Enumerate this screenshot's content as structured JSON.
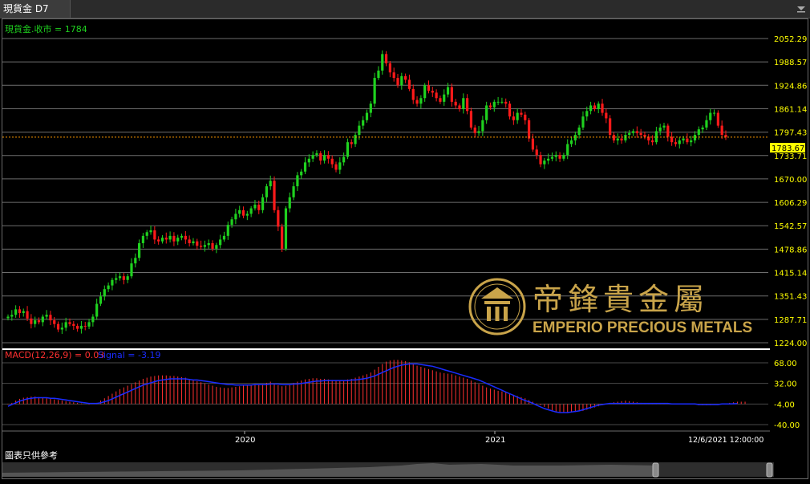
{
  "tab": {
    "title": "現貨金 D7"
  },
  "price_panel": {
    "legend": "現貨金.收市 = 1784",
    "current_price_label": "1783.67"
  },
  "macd_panel": {
    "legend_macd": "MACD(12,26,9) = 0.03",
    "legend_signal": "Signal = -3.19"
  },
  "footer": {
    "disclaimer": "圖表只供參考",
    "date_label": "12/6/2021 12:00:00"
  },
  "watermark": {
    "chinese": "帝鋒貴金屬",
    "english": "EMPERIO PRECIOUS METALS"
  },
  "colors": {
    "up": "#1fd11f",
    "down": "#ff1a1a",
    "signal": "#1a2cff",
    "macd_text": "#ff3030",
    "axis_text": "#ffff00",
    "current_price_bg": "#ffff00",
    "logo_gold": "#c9a44a",
    "hist": "#ff3030",
    "price_line": "#ff9900"
  },
  "chart_data": [
    {
      "type": "candlestick",
      "title": "現貨金.收市 = 1784",
      "y_ticks": [
        "2052.29",
        "1988.57",
        "1924.86",
        "1861.14",
        "1797.43",
        "1733.71",
        "1670.00",
        "1606.29",
        "1542.57",
        "1478.86",
        "1415.14",
        "1351.43",
        "1287.71",
        "1224.00"
      ],
      "ylim": [
        1224.0,
        2052.29
      ],
      "x_labels": [
        "2020",
        "2021"
      ],
      "last_close": 1783.67,
      "series": [
        {
          "name": "現貨金.收市",
          "close": [
            1295,
            1300,
            1315,
            1305,
            1310,
            1290,
            1275,
            1285,
            1280,
            1295,
            1300,
            1285,
            1275,
            1260,
            1265,
            1280,
            1275,
            1270,
            1262,
            1270,
            1268,
            1280,
            1295,
            1330,
            1350,
            1370,
            1380,
            1395,
            1400,
            1405,
            1395,
            1405,
            1440,
            1455,
            1495,
            1515,
            1525,
            1530,
            1505,
            1500,
            1510,
            1505,
            1515,
            1500,
            1510,
            1515,
            1505,
            1495,
            1500,
            1488,
            1485,
            1490,
            1495,
            1480,
            1490,
            1505,
            1515,
            1545,
            1560,
            1575,
            1585,
            1570,
            1575,
            1590,
            1600,
            1585,
            1620,
            1650,
            1665,
            1585,
            1540,
            1480,
            1590,
            1620,
            1650,
            1680,
            1690,
            1715,
            1725,
            1735,
            1740,
            1720,
            1735,
            1725,
            1710,
            1695,
            1715,
            1730,
            1770,
            1765,
            1790,
            1815,
            1830,
            1850,
            1875,
            1945,
            1965,
            2010,
            1985,
            1960,
            1945,
            1925,
            1950,
            1940,
            1915,
            1885,
            1875,
            1890,
            1925,
            1910,
            1905,
            1890,
            1880,
            1900,
            1920,
            1880,
            1870,
            1860,
            1890,
            1855,
            1810,
            1795,
            1800,
            1830,
            1870,
            1865,
            1880,
            1880,
            1880,
            1875,
            1840,
            1830,
            1850,
            1845,
            1830,
            1780,
            1750,
            1735,
            1710,
            1720,
            1725,
            1730,
            1735,
            1725,
            1735,
            1765,
            1775,
            1790,
            1810,
            1840,
            1855,
            1870,
            1860,
            1875,
            1850,
            1835,
            1790,
            1775,
            1780,
            1775,
            1790,
            1795,
            1800,
            1795,
            1790,
            1785,
            1775,
            1770,
            1800,
            1810,
            1815,
            1785,
            1770,
            1765,
            1775,
            1780,
            1770,
            1775,
            1790,
            1805,
            1810,
            1830,
            1850,
            1850,
            1815,
            1790,
            1784
          ]
        }
      ]
    },
    {
      "type": "line+bar",
      "title": "MACD(12,26,9) = 0.03",
      "y_ticks": [
        "68.00",
        "32.00",
        "-4.00",
        "-40.00"
      ],
      "ylim": [
        -40.0,
        68.0
      ],
      "series": [
        {
          "name": "MACD",
          "values": [
            -5,
            -2,
            2,
            5,
            7,
            8,
            9,
            9,
            8,
            7,
            6,
            5,
            4,
            3,
            2,
            1,
            0,
            -1,
            -2,
            -3,
            -4,
            -5,
            -4,
            -2,
            2,
            6,
            10,
            14,
            18,
            22,
            25,
            28,
            31,
            34,
            37,
            40,
            42,
            44,
            45,
            46,
            46,
            46,
            45,
            45,
            44,
            43,
            42,
            40,
            38,
            36,
            34,
            32,
            30,
            28,
            26,
            25,
            24,
            24,
            25,
            26,
            27,
            28,
            29,
            30,
            31,
            30,
            31,
            33,
            35,
            32,
            29,
            27,
            28,
            30,
            33,
            35,
            37,
            39,
            40,
            41,
            41,
            40,
            40,
            39,
            38,
            37,
            36,
            37,
            39,
            40,
            42,
            44,
            46,
            48,
            51,
            56,
            61,
            66,
            70,
            72,
            73,
            73,
            72,
            71,
            69,
            66,
            63,
            61,
            59,
            57,
            55,
            53,
            51,
            50,
            49,
            48,
            46,
            44,
            42,
            40,
            37,
            34,
            31,
            28,
            25,
            23,
            21,
            19,
            18,
            16,
            14,
            12,
            10,
            8,
            6,
            3,
            0,
            -3,
            -6,
            -9,
            -12,
            -15,
            -17,
            -18,
            -19,
            -19,
            -19,
            -18,
            -17,
            -16,
            -14,
            -12,
            -10,
            -8,
            -6,
            -4,
            -2,
            -1,
            0,
            1,
            2,
            1,
            0,
            -1,
            -2,
            -3,
            -3,
            -3,
            -3,
            -3,
            -3,
            -3,
            -4,
            -4,
            -4,
            -4,
            -4,
            -5,
            -5,
            -6,
            -6,
            -6,
            -6,
            -5,
            -5,
            -4,
            -3,
            -2,
            -1,
            0,
            0,
            0.03
          ]
        },
        {
          "name": "Signal",
          "values": [
            -8,
            -5,
            -2,
            1,
            3,
            5,
            6,
            7,
            7,
            7,
            7,
            6,
            6,
            5,
            4,
            3,
            2,
            1,
            0,
            -1,
            -2,
            -3,
            -3,
            -3,
            -2,
            0,
            2,
            5,
            8,
            11,
            14,
            17,
            20,
            23,
            26,
            29,
            31,
            33,
            35,
            37,
            38,
            39,
            40,
            40,
            40,
            40,
            40,
            39,
            38,
            38,
            37,
            36,
            35,
            34,
            33,
            32,
            31,
            30,
            30,
            29,
            29,
            29,
            29,
            29,
            30,
            30,
            30,
            30,
            31,
            31,
            31,
            30,
            30,
            30,
            31,
            31,
            32,
            33,
            34,
            35,
            36,
            36,
            37,
            37,
            37,
            37,
            37,
            37,
            37,
            38,
            38,
            39,
            40,
            41,
            43,
            45,
            48,
            51,
            54,
            57,
            60,
            62,
            64,
            65,
            66,
            66,
            66,
            65,
            64,
            63,
            62,
            60,
            58,
            56,
            54,
            52,
            50,
            48,
            46,
            44,
            42,
            40,
            38,
            35,
            32,
            29,
            26,
            23,
            20,
            17,
            14,
            11,
            8,
            5,
            2,
            0,
            -3,
            -6,
            -9,
            -12,
            -14,
            -16,
            -18,
            -19,
            -19,
            -19,
            -18,
            -17,
            -16,
            -14,
            -12,
            -10,
            -8,
            -6,
            -5,
            -4,
            -3,
            -3,
            -3,
            -3,
            -3,
            -3,
            -3,
            -3,
            -3,
            -3,
            -3,
            -3,
            -3,
            -3,
            -3,
            -3,
            -4,
            -4,
            -4,
            -4,
            -4,
            -4,
            -4,
            -5,
            -5,
            -5,
            -5,
            -5,
            -5,
            -4,
            -4,
            -4,
            -3.5,
            -3.19
          ]
        }
      ]
    }
  ]
}
